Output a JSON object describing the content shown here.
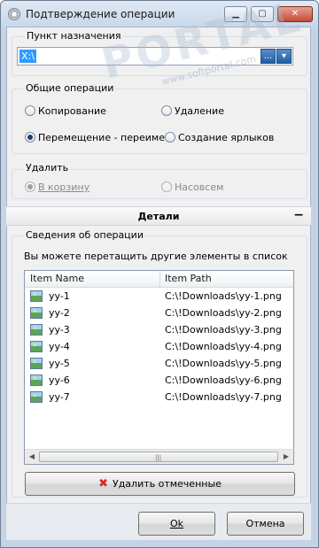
{
  "window": {
    "title": "Подтверждение операции",
    "buttons": {
      "minimize": "▁",
      "maximize": "▢",
      "close": "✕"
    }
  },
  "destination": {
    "label": "Пункт назначения",
    "value": "X:\\",
    "browse_label": "...",
    "dropdown_icon": "chevron-down-icon"
  },
  "operations": {
    "label": "Общие операции",
    "options": [
      {
        "label": "Копирование",
        "selected": false
      },
      {
        "label": "Удаление",
        "selected": false
      },
      {
        "label": "Перемещение - переиме",
        "selected": true
      },
      {
        "label": "Создание ярлыков",
        "selected": false
      }
    ]
  },
  "delete_mode": {
    "label": "Удалить",
    "options": [
      {
        "label": "В корзину",
        "selected": true,
        "disabled": true
      },
      {
        "label": "Насовсем",
        "selected": false,
        "disabled": true
      }
    ]
  },
  "details": {
    "title": "Детали",
    "toggle": "−"
  },
  "operation_info": {
    "label": "Сведения об операции",
    "hint": "Вы можете перетащить другие элементы в список",
    "columns": [
      "Item Name",
      "Item Path"
    ],
    "rows": [
      {
        "name": "yy-1",
        "path": "C:\\!Downloads\\yy-1.png"
      },
      {
        "name": "yy-2",
        "path": "C:\\!Downloads\\yy-2.png"
      },
      {
        "name": "yy-3",
        "path": "C:\\!Downloads\\yy-3.png"
      },
      {
        "name": "yy-4",
        "path": "C:\\!Downloads\\yy-4.png"
      },
      {
        "name": "yy-5",
        "path": "C:\\!Downloads\\yy-5.png"
      },
      {
        "name": "yy-6",
        "path": "C:\\!Downloads\\yy-6.png"
      },
      {
        "name": "yy-7",
        "path": "C:\\!Downloads\\yy-7.png"
      }
    ],
    "delete_button": "Удалить отмеченные"
  },
  "footer": {
    "ok": "Ok",
    "cancel": "Отмена"
  },
  "watermark": {
    "big": "PORTAL",
    "small": "www.softportal.com"
  },
  "colors": {
    "accent": "#3399ff",
    "title_bg": "#c4d4e6",
    "delete_icon": "#d42b1e"
  }
}
